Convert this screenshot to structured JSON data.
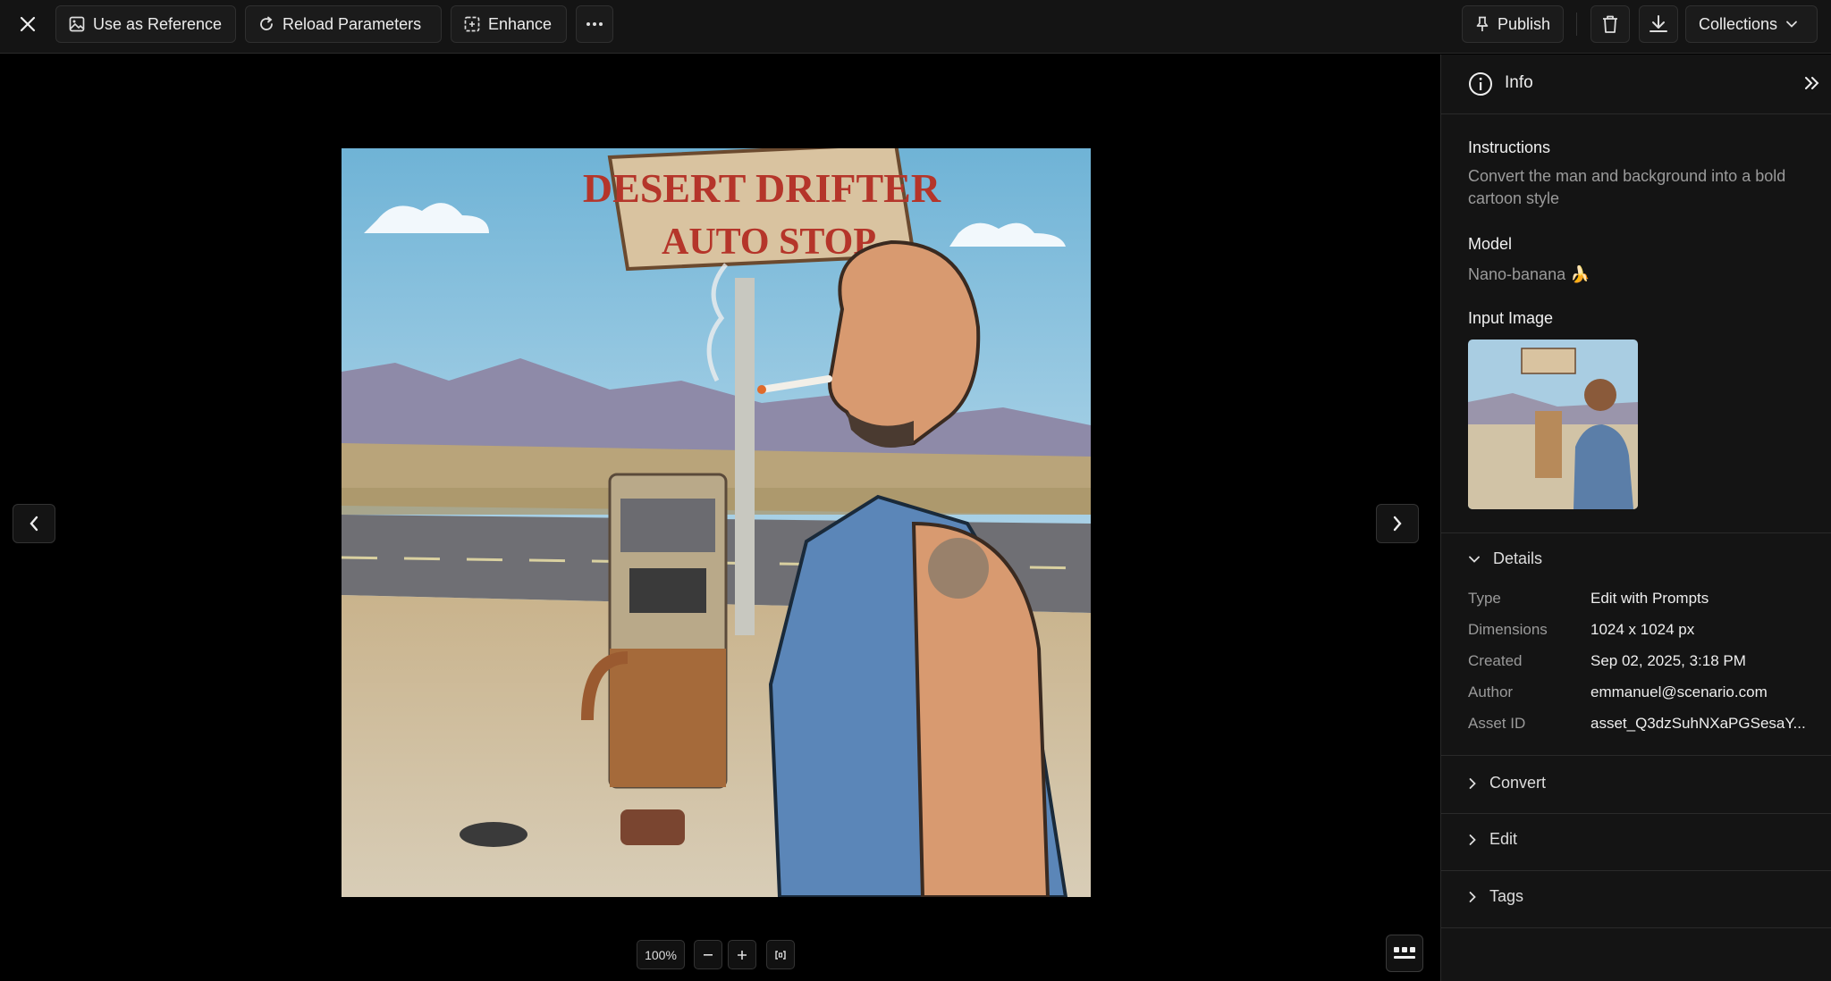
{
  "toolbar": {
    "use_as_reference": "Use as Reference",
    "reload_parameters": "Reload Parameters",
    "enhance": "Enhance",
    "publish": "Publish",
    "collections": "Collections"
  },
  "image": {
    "sign_line1": "DESERT DRIFTER",
    "sign_line2": "AUTO STOP"
  },
  "zoom": {
    "level": "100%"
  },
  "panel": {
    "header": "Info",
    "instructions_title": "Instructions",
    "instructions_text": "Convert the man and background into a bold cartoon style",
    "model_title": "Model",
    "model_value": "Nano-banana 🍌",
    "input_image_title": "Input Image",
    "details_title": "Details",
    "details": [
      {
        "label": "Type",
        "value": "Edit with Prompts"
      },
      {
        "label": "Dimensions",
        "value": "1024 x 1024 px"
      },
      {
        "label": "Created",
        "value": "Sep 02, 2025, 3:18 PM"
      },
      {
        "label": "Author",
        "value": "emmanuel@scenario.com"
      },
      {
        "label": "Asset ID",
        "value": "asset_Q3dzSuhNXaPGSesaY..."
      }
    ],
    "sections": [
      "Convert",
      "Edit",
      "Tags"
    ]
  },
  "colors": {
    "background": "#000000",
    "panel": "#141414",
    "muted_text": "#9a9a9a"
  }
}
